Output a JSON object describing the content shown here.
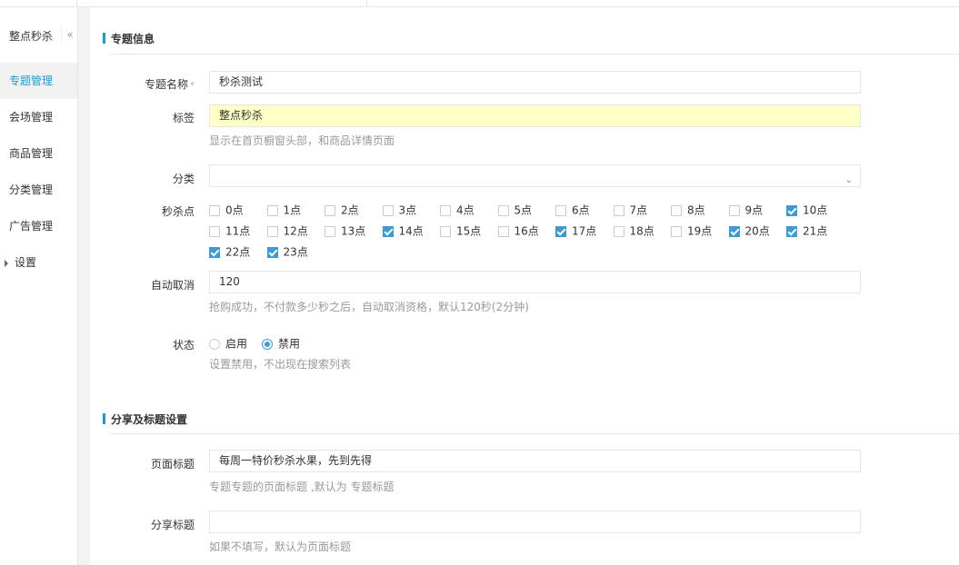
{
  "sidebar": {
    "title": "整点秒杀",
    "collapse_icon": "«",
    "items": [
      {
        "label": "专题管理",
        "active": true
      },
      {
        "label": "会场管理"
      },
      {
        "label": "商品管理"
      },
      {
        "label": "分类管理"
      },
      {
        "label": "广告管理"
      },
      {
        "label": "设置"
      }
    ]
  },
  "section1": {
    "title": "专题信息",
    "name_label": "专题名称",
    "required_mark": "*",
    "name_value": "秒杀测试",
    "tag_label": "标签",
    "tag_value": "整点秒杀",
    "tag_help": "显示在首页橱窗头部，和商品详情页面",
    "category_label": "分类",
    "category_value": "",
    "hours_label": "秒杀点",
    "hours": [
      {
        "label": "0点",
        "checked": false
      },
      {
        "label": "1点",
        "checked": false
      },
      {
        "label": "2点",
        "checked": false
      },
      {
        "label": "3点",
        "checked": false
      },
      {
        "label": "4点",
        "checked": false
      },
      {
        "label": "5点",
        "checked": false
      },
      {
        "label": "6点",
        "checked": false
      },
      {
        "label": "7点",
        "checked": false
      },
      {
        "label": "8点",
        "checked": false
      },
      {
        "label": "9点",
        "checked": false
      },
      {
        "label": "10点",
        "checked": true
      },
      {
        "label": "11点",
        "checked": false
      },
      {
        "label": "12点",
        "checked": false
      },
      {
        "label": "13点",
        "checked": false
      },
      {
        "label": "14点",
        "checked": true
      },
      {
        "label": "15点",
        "checked": false
      },
      {
        "label": "16点",
        "checked": false
      },
      {
        "label": "17点",
        "checked": true
      },
      {
        "label": "18点",
        "checked": false
      },
      {
        "label": "19点",
        "checked": false
      },
      {
        "label": "20点",
        "checked": true
      },
      {
        "label": "21点",
        "checked": true
      },
      {
        "label": "22点",
        "checked": true
      },
      {
        "label": "23点",
        "checked": true
      }
    ],
    "autocancel_label": "自动取消",
    "autocancel_value": "120",
    "autocancel_help": "抢购成功，不付款多少秒之后，自动取消资格，默认120秒(2分钟)",
    "status_label": "状态",
    "status_options": [
      {
        "label": "启用",
        "selected": false
      },
      {
        "label": "禁用",
        "selected": true
      }
    ],
    "status_help": "设置禁用，不出现在搜索列表"
  },
  "section2": {
    "title": "分享及标题设置",
    "page_title_label": "页面标题",
    "page_title_value": "每周一特价秒杀水果，先到先得",
    "page_title_help": "专题专题的页面标题 ,默认为 专题标题",
    "share_title_label": "分享标题",
    "share_title_value": "",
    "share_title_help": "如果不填写，默认为页面标题"
  }
}
